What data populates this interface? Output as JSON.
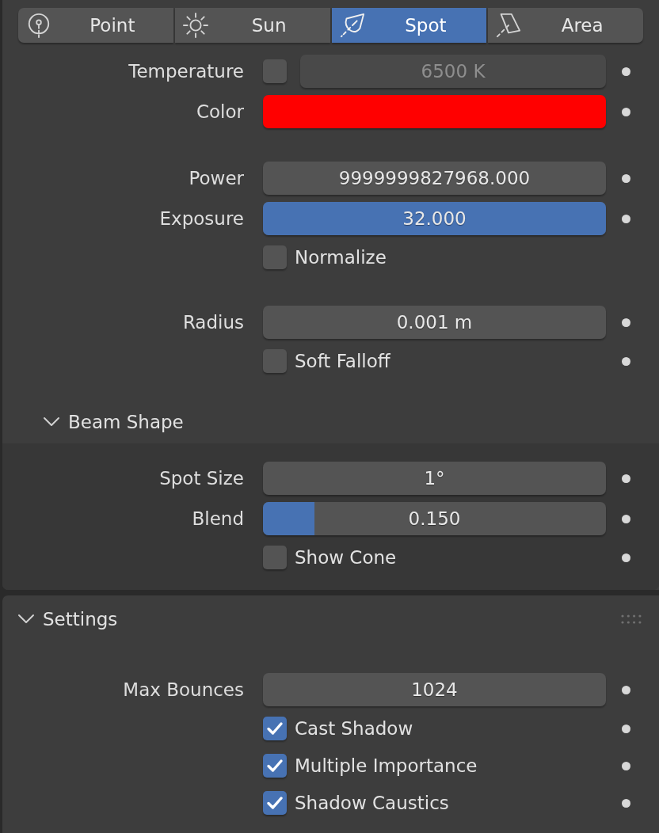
{
  "light_type_tabs": [
    {
      "label": "Point",
      "selected": false
    },
    {
      "label": "Sun",
      "selected": false
    },
    {
      "label": "Spot",
      "selected": true
    },
    {
      "label": "Area",
      "selected": false
    }
  ],
  "light_groups": [
    {
      "rows": [
        {
          "kind": "toggle_number",
          "label": "Temperature",
          "checked": false,
          "value": "6500 K",
          "disabled": true,
          "animatable": true
        },
        {
          "kind": "color",
          "label": "Color",
          "color": "#ff0000",
          "animatable": true
        }
      ]
    },
    {
      "rows": [
        {
          "kind": "number",
          "label": "Power",
          "value": "9999999827968.000",
          "animatable": true
        },
        {
          "kind": "slider",
          "label": "Exposure",
          "value": "32.000",
          "level": 1,
          "animatable": true
        },
        {
          "kind": "checkbox",
          "label": "Normalize",
          "checked": false,
          "animatable": false
        }
      ]
    },
    {
      "rows": [
        {
          "kind": "number",
          "label": "Radius",
          "value": "0.001 m",
          "animatable": true
        },
        {
          "kind": "checkbox",
          "label": "Soft Falloff",
          "checked": false,
          "animatable": true
        }
      ]
    }
  ],
  "beam_shape": {
    "title": "Beam Shape",
    "expanded": true,
    "rows": [
      {
        "kind": "number",
        "label": "Spot Size",
        "value": "1°",
        "animatable": true
      },
      {
        "kind": "slider",
        "label": "Blend",
        "value": "0.150",
        "level": 0.15,
        "animatable": true
      },
      {
        "kind": "checkbox",
        "label": "Show Cone",
        "checked": false,
        "animatable": true
      }
    ]
  },
  "settings": {
    "title": "Settings",
    "expanded": true,
    "rows": [
      {
        "kind": "number",
        "label": "Max Bounces",
        "value": "1024",
        "animatable": true
      },
      {
        "kind": "checkbox",
        "label": "Cast Shadow",
        "checked": true,
        "animatable": true
      },
      {
        "kind": "checkbox",
        "label": "Multiple Importance",
        "checked": true,
        "animatable": true
      },
      {
        "kind": "checkbox",
        "label": "Shadow Caustics",
        "checked": true,
        "animatable": true
      }
    ]
  }
}
